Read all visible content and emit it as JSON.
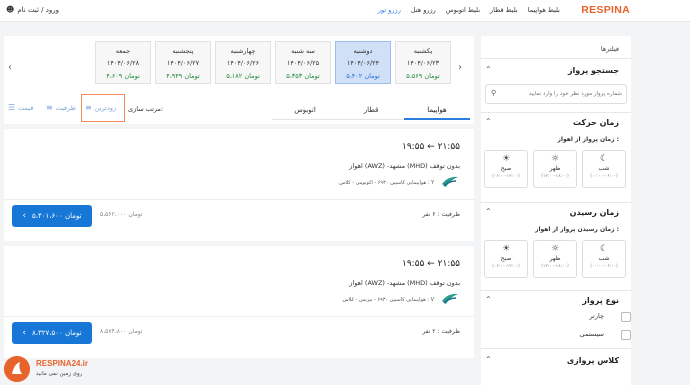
{
  "header": {
    "brand": "RESPINA",
    "nav": [
      "بلیط هواپیما",
      "بلیط قطار",
      "بلیط اتوبوس",
      "رزرو هتل",
      "رزرو تور"
    ],
    "active_nav": "رزرو تور",
    "login": "ورود / ثبت نام"
  },
  "sidebar": {
    "title": "فیلترها",
    "search_section": {
      "heading": "جستجو پرواز",
      "placeholder": "شماره پرواز مورد نظر خود را وارد نمایید"
    },
    "departure": {
      "heading": "زمان حرکت",
      "sub": "زمان پرواز از اهواز :",
      "slots": [
        {
          "icon": "moon-icon",
          "name": "شب",
          "range": "(۰۰:۰۰-۰۶:۰۰)"
        },
        {
          "icon": "sun-icon",
          "name": "ظهر",
          "range": "(۱۲:۰۰-۱۸:۰۰)"
        },
        {
          "icon": "sunrise-icon",
          "name": "صبح",
          "range": "(۰۶:۰۰-۱۲:۰۰)"
        }
      ]
    },
    "arrival": {
      "heading": "زمان رسیدن",
      "sub": "زمان رسیدن پرواز از اهواز :",
      "slots": [
        {
          "icon": "moon-icon",
          "name": "شب",
          "range": "(۰۰:۰۰-۰۶:۰۰)"
        },
        {
          "icon": "sun-icon",
          "name": "ظهر",
          "range": "(۱۲:۰۰-۱۸:۰۰)"
        },
        {
          "icon": "sunrise-icon",
          "name": "صبح",
          "range": "(۰۶:۰۰-۱۲:۰۰)"
        }
      ]
    },
    "flight_type": {
      "heading": "نوع پرواز",
      "options": [
        "چارتر",
        "سیستمی"
      ]
    },
    "class_section": {
      "heading": "کلاس پروازی"
    }
  },
  "dates": [
    {
      "day": "یکشنبه",
      "date": "۱۴۰۴/۰۶/۲۳",
      "price": "۵،۵۶۹ تومان",
      "selected": false
    },
    {
      "day": "دوشنبه",
      "date": "۱۴۰۴/۰۶/۲۴",
      "price": "۵،۴۰۲ تومان",
      "selected": true
    },
    {
      "day": "سه شنبه",
      "date": "۱۴۰۴/۰۶/۲۵",
      "price": "۵،۳۵۳ تومان",
      "selected": false
    },
    {
      "day": "چهارشنبه",
      "date": "۱۴۰۴/۰۶/۲۶",
      "price": "۵،۱۸۲ تومان",
      "selected": false
    },
    {
      "day": "پنجشنبه",
      "date": "۱۴۰۴/۰۶/۲۷",
      "price": "۴،۹۴۹ تومان",
      "selected": false
    },
    {
      "day": "جمعه",
      "date": "۱۴۰۴/۰۶/۲۸",
      "price": "۴،۶۰۹ تومان",
      "selected": false
    }
  ],
  "tabs": [
    "هواپیما",
    "قطار",
    "اتوبوس"
  ],
  "sort": {
    "label": "مرتب سازی:",
    "options": [
      "زودترین",
      "ظرفیت",
      "قیمت"
    ]
  },
  "flights": [
    {
      "time": "۱۹:۵۵ ← ۲۱:۵۵",
      "route": "اهواز (AWZ) -مشهد (MHD)   بدون توقف",
      "airline": "هواپیمایی کاسپین ۶۹۳۰ - اکونومی - کلاس : Y",
      "capacity": "ظرفیت : ۶ نفر",
      "old_price": "۵،۵۶۲،۰۰۰ تومان",
      "price": "۵،۴۰۱،۶۰۰ تومان"
    },
    {
      "time": "۱۹:۵۵ ← ۲۱:۵۵",
      "route": "اهواز (AWZ) -مشهد (MHD)   بدون توقف",
      "airline": "هواپیمایی کاسپین ۶۹۳۰ - بیزنس - کلاس : V",
      "capacity": "ظرفیت : ۲ نفر",
      "old_price": "۸،۵۷۴،۸۰۰ تومان",
      "price": "۸،۳۲۷،۵۰۰ تومان"
    }
  ],
  "watermark": {
    "line1": "RESPINA24.ir",
    "line2": "روی زمین نمی مانید"
  },
  "colors": {
    "brand": "#e8622c",
    "primary": "#1677d6",
    "selected_date": "#cfe0f7",
    "highlight": "#f18c5e"
  }
}
